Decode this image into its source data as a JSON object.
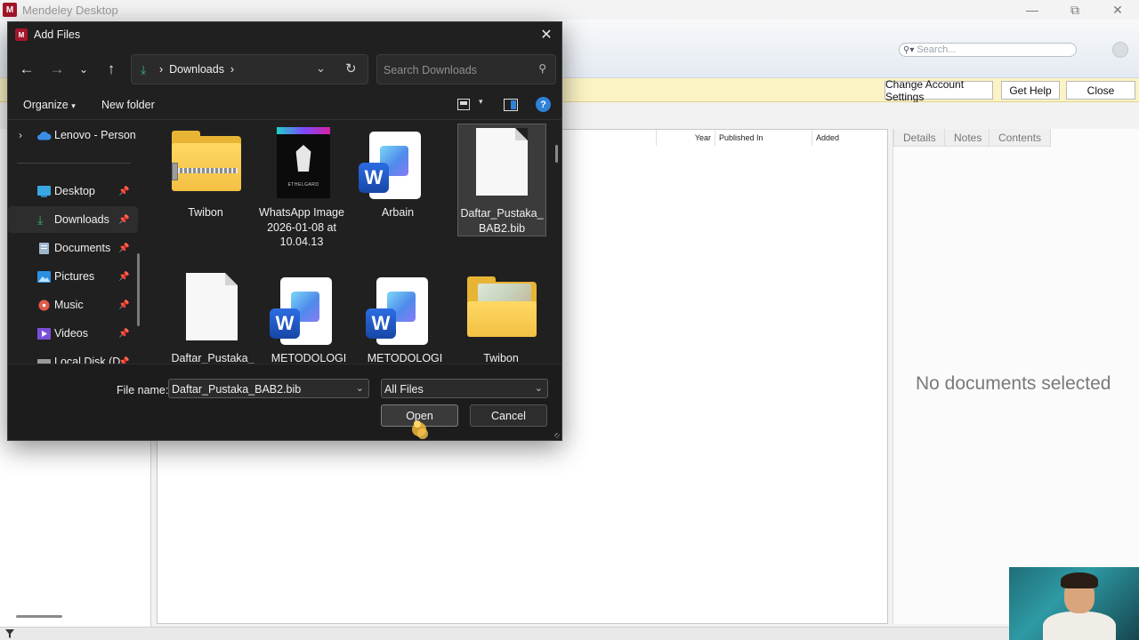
{
  "app": {
    "logo_text": "M",
    "title": "Mendeley Desktop",
    "search_placeholder": "Search..."
  },
  "info_bar": {
    "buttons": [
      "Change Account Settings",
      "Get Help",
      "Close"
    ]
  },
  "doc_list": {
    "columns": [
      "Year",
      "Published In",
      "Added"
    ]
  },
  "details": {
    "tabs": [
      "Details",
      "Notes",
      "Contents"
    ],
    "empty_message": "No documents selected"
  },
  "dialog": {
    "title": "Add Files",
    "address": "Downloads",
    "search_placeholder": "Search Downloads",
    "organize_label": "Organize",
    "new_folder_label": "New folder",
    "nav_items": [
      {
        "label": "Lenovo - Person",
        "icon": "cloud-icon"
      },
      {
        "label": "Desktop",
        "icon": "desktop-icon"
      },
      {
        "label": "Downloads",
        "icon": "download-icon"
      },
      {
        "label": "Documents",
        "icon": "documents-icon"
      },
      {
        "label": "Pictures",
        "icon": "pictures-icon"
      },
      {
        "label": "Music",
        "icon": "music-icon"
      },
      {
        "label": "Videos",
        "icon": "videos-icon"
      },
      {
        "label": "Local Disk (D",
        "icon": "disk-icon"
      }
    ],
    "files": [
      {
        "name": "Twibon",
        "type": "zip-folder"
      },
      {
        "name": "WhatsApp Image 2026-01-08 at 10.04.13",
        "type": "image",
        "image_text": "ETHELGARD"
      },
      {
        "name": "Arbain",
        "type": "word-doc"
      },
      {
        "name": "Daftar_Pustaka_BAB2.bib",
        "type": "file",
        "selected": true
      },
      {
        "name": "Daftar_Pustaka_",
        "type": "file"
      },
      {
        "name": "METODOLOGI",
        "type": "word-doc"
      },
      {
        "name": "METODOLOGI",
        "type": "word-doc"
      },
      {
        "name": "Twibon",
        "type": "photo-folder"
      }
    ],
    "word_badge": "W",
    "file_name_label": "File name:",
    "file_name_value": "Daftar_Pustaka_BAB2.bib",
    "file_type_value": "All Files",
    "open_label": "Open",
    "cancel_label": "Cancel"
  },
  "colors": {
    "accent": "#2f82d8",
    "mendeley_red": "#a4162a",
    "download_green": "#39b26f",
    "info_bar": "#fbf3c4"
  }
}
